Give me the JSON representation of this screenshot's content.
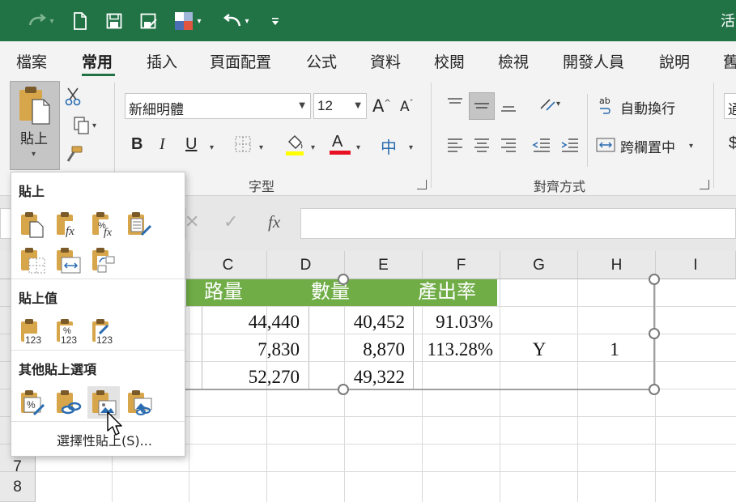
{
  "titlebar": {
    "title_fragment": "活",
    "quick_access": [
      "redo-icon",
      "new-file-icon",
      "save-icon",
      "save-as-icon",
      "theme-icon",
      "undo-icon",
      "customize-icon"
    ]
  },
  "tabs": [
    {
      "label": "檔案"
    },
    {
      "label": "常用"
    },
    {
      "label": "插入"
    },
    {
      "label": "頁面配置"
    },
    {
      "label": "公式"
    },
    {
      "label": "資料"
    },
    {
      "label": "校閱"
    },
    {
      "label": "檢視"
    },
    {
      "label": "開發人員"
    },
    {
      "label": "說明"
    },
    {
      "label": "舊"
    }
  ],
  "ribbon": {
    "paste_label": "貼上",
    "font_name": "新細明體",
    "font_size": "12",
    "font_group_label": "字型",
    "align_group_label": "對齊方式",
    "wrap_text_label": "自動換行",
    "merge_center_label": "跨欄置中",
    "wrap_prefix": "ab",
    "bold": "B",
    "italic": "I",
    "underline": "U",
    "font_grow": "A",
    "font_shrink": "A",
    "font_color_letter": "A",
    "phonetic": "中",
    "next_group_fragment": "通"
  },
  "formula_bar": {
    "fx": "fx"
  },
  "sheet": {
    "columns": [
      "C",
      "D",
      "E",
      "F",
      "G",
      "H",
      "I"
    ],
    "rows": [
      "7",
      "8"
    ],
    "header_row": [
      "路量",
      "數量",
      "產出率"
    ],
    "data_rows": [
      [
        "44,440",
        "40,452",
        "91.03%",
        "",
        ""
      ],
      [
        "7,830",
        "8,870",
        "113.28%",
        "Y",
        "1"
      ],
      [
        "52,270",
        "49,322",
        "",
        "",
        ""
      ]
    ]
  },
  "paste_menu": {
    "section_paste": "貼上",
    "section_values": "貼上值",
    "section_other": "其他貼上選項",
    "special_label": "選擇性貼上(S)...",
    "values_badge": "123",
    "pct": "%",
    "fx": "fx"
  },
  "colors": {
    "brand": "#217346",
    "header_fill": "#70ad47",
    "font_color": "#e81123",
    "highlight": "#ffff00"
  }
}
